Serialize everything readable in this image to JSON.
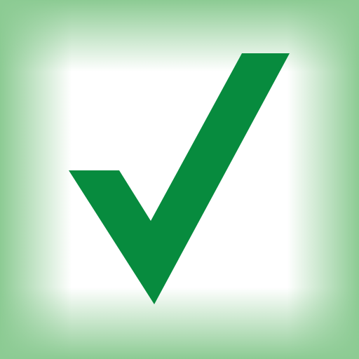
{
  "icon": {
    "name": "checkmark-icon",
    "colors": {
      "check": "#078B3E",
      "center": "#FFFFFF",
      "edge": "#8CCB93"
    }
  }
}
